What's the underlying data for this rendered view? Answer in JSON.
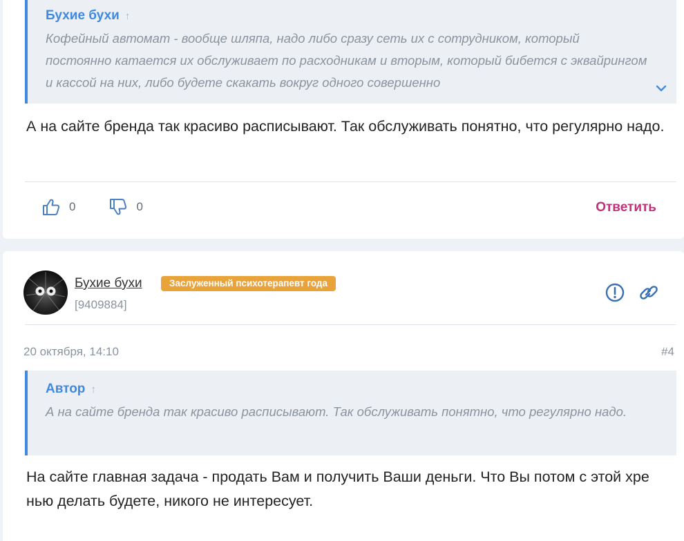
{
  "post1": {
    "quote": {
      "author": "Бухие бухи",
      "arrow": "↑",
      "text": "Кофейный автомат - вообще шляпа, надо либо сразу сеть их с сотрудником, который постоянно катается их обслуживает по расходникам и вторым, который бибется с эквайрингом и кассой на них, либо будете скакать вокруг одного совершенно"
    },
    "body": "А на сайте бренда так красиво расписывают. Так обслуживать понятно, что регулярно надо.",
    "likes": "0",
    "dislikes": "0",
    "reply_label": "Ответить"
  },
  "post2": {
    "username": "Бухие бухи",
    "badge": "Заслуженный психотерапевт года",
    "user_id": "[9409884]",
    "date": "20 октября, 14:10",
    "number": "#4",
    "quote": {
      "author": "Автор",
      "arrow": "↑",
      "text": "А на сайте бренда так красиво расписывают. Так обслуживать понятно, что регулярно надо."
    },
    "body": "На сайте главная задача - продать Вам и получить Ваши деньги. Что Вы потом с этой хре нью делать будете, никого не интересует."
  },
  "colors": {
    "accent": "#3f8ae0",
    "reply": "#c0317a",
    "badge": "#e8a33a",
    "muted": "#8a939e"
  },
  "icons": {
    "like": "thumbs-up-icon",
    "dislike": "thumbs-down-icon",
    "report": "exclamation-circle-icon",
    "link": "link-icon",
    "expand": "chevron-down-icon"
  }
}
